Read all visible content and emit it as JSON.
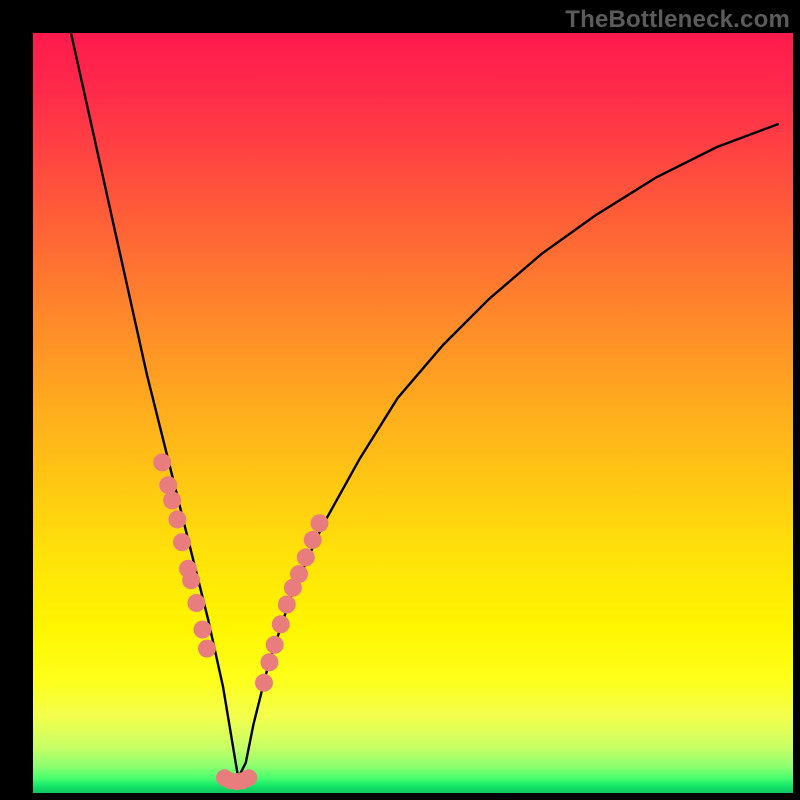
{
  "watermark": "TheBottleneck.com",
  "chart_data": {
    "type": "line",
    "title": "",
    "xlabel": "",
    "ylabel": "",
    "xlim": [
      0,
      100
    ],
    "ylim": [
      0,
      100
    ],
    "grid": false,
    "legend": "none",
    "description": "V-shaped bottleneck curve over vertical rainbow gradient (red→yellow→green). Minimum near x≈27. Salmon dots cluster along the curve in two bands on either side of the trough; a short horizontal cluster sits at the bottom of the V.",
    "series": [
      {
        "name": "curve",
        "x": [
          5,
          7,
          9,
          11,
          13,
          15,
          17,
          19,
          21,
          23,
          25,
          26,
          27,
          28,
          29,
          31,
          34,
          38,
          43,
          48,
          54,
          60,
          67,
          74,
          82,
          90,
          98
        ],
        "y": [
          100,
          91,
          82,
          73,
          64,
          55,
          47,
          39,
          31,
          23,
          14,
          8,
          2,
          4,
          9,
          17,
          26,
          35,
          44,
          52,
          59,
          65,
          71,
          76,
          81,
          85,
          88
        ]
      },
      {
        "name": "dots-left",
        "x": [
          17.0,
          17.8,
          18.3,
          19.0,
          19.6,
          20.4,
          20.8,
          21.5,
          22.3,
          22.9
        ],
        "y": [
          43.5,
          40.5,
          38.5,
          36.0,
          33.0,
          29.5,
          28.0,
          25.0,
          21.5,
          19.0
        ]
      },
      {
        "name": "dots-right",
        "x": [
          30.4,
          31.1,
          31.8,
          32.6,
          33.4,
          34.2,
          35.0,
          35.9,
          36.8,
          37.7
        ],
        "y": [
          14.5,
          17.2,
          19.5,
          22.2,
          24.8,
          27.0,
          28.8,
          31.0,
          33.3,
          35.5
        ]
      },
      {
        "name": "dots-bottom",
        "x": [
          25.2,
          26.0,
          26.8,
          27.6,
          28.4
        ],
        "y": [
          2.0,
          1.6,
          1.5,
          1.6,
          2.0
        ]
      }
    ],
    "colors": {
      "curve": "#000000",
      "dots": "#e97d7d"
    }
  }
}
